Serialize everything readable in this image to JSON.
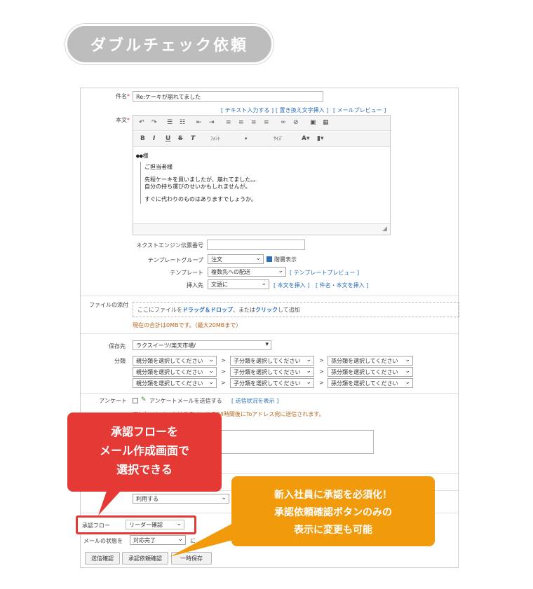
{
  "badge_title": "ダブルチェック依頼",
  "form": {
    "subject_label": "件名",
    "subject_value": "Re:ケーキが崩れてました",
    "editor_links": [
      "[ テキスト入力する ]",
      "[ 置き換え文字挿入 ]",
      "[ メールプレビュー ]"
    ],
    "body_label": "本文",
    "font_label": "ﾌｫﾝﾄ",
    "size_label": "ｻｲｽﾞ",
    "body_lines": [
      "●●様",
      "ご担当者様",
      "先程ケーキを買いましたが、崩れてました。。",
      "自分の持ち運びのせいかもしれませんが。",
      "すぐに代わりのものはありますでしょうか。"
    ],
    "tracking_label": "ネクストエンジン伝票番号",
    "template_group_label": "テンプレートグループ",
    "template_group_value": "注文",
    "hierarchy_label": "階層表示",
    "template_label": "テンプレート",
    "template_value": "複数先への配送",
    "template_preview_link": "[ テンプレートプレビュー ]",
    "insert_label": "挿入先",
    "insert_value": "文頭に",
    "insert_body_link": "[ 本文を挿入 ]",
    "insert_subject_body_link": "[ 件名・本文を挿入 ]",
    "attach_label": "ファイルの添付",
    "attach_text_1": "ここにファイルを",
    "attach_text_drag": "ドラッグ＆ドロップ",
    "attach_text_2": "、または",
    "attach_text_click": "クリック",
    "attach_text_3": "して追加",
    "attach_total": "現在の合計は0MBです。（最大20MBまで）",
    "save_label": "保存先",
    "save_value": "ラクスイーツ/楽天市場/",
    "category_label": "分類",
    "cat_parent": "親分類を選択してください",
    "cat_child": "子分類を選択してください",
    "cat_grandchild": "孫分類を選択してください",
    "cat_sep": ">",
    "survey_label": "アンケート",
    "survey_text": "アンケートメールを送信する",
    "survey_link": "[ 送信状況を表示 ]",
    "survey_note": "アンケートメールはこのメールの24時間後にToアドレス宛に送信されます。",
    "usage_value": "利用する",
    "approval_label": "承認フロー",
    "approval_value": "リーダー確認",
    "status_label": "メールの状態を",
    "status_value": "対応完了",
    "status_suffix": "に",
    "btn_send_confirm": "送信確認",
    "btn_approval_request": "承認依頼確認",
    "btn_temp_save": "一時保存"
  },
  "callouts": {
    "red": [
      "承認フローを",
      "メール作成画面で",
      "選択できる"
    ],
    "orange": [
      "新入社員に承認を必須化！",
      "承認依頼確認ボタンのみの",
      "表示に変更も可能"
    ]
  }
}
